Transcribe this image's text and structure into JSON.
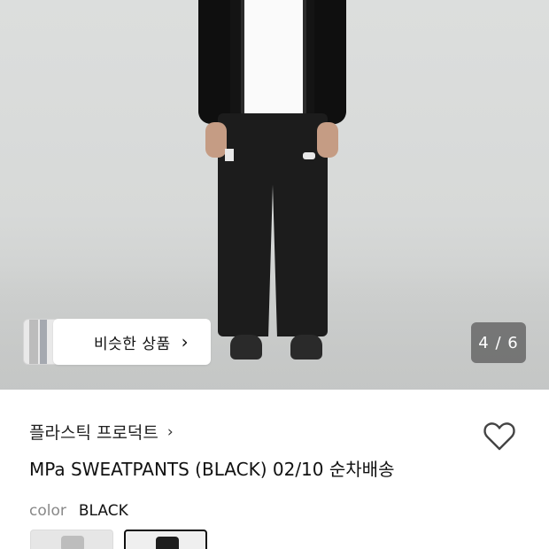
{
  "gallery": {
    "similar_products_label": "비슷한 상품",
    "page_indicator": "4 / 6",
    "current_index": 4,
    "total_images": 6
  },
  "product": {
    "brand": "플라스틱 프로덕트",
    "title": "MPa SWEATPANTS (BLACK) 02/10 순차배송",
    "color_label": "color",
    "color_value": "BLACK"
  },
  "swatches": [
    {
      "name": "grey",
      "selected": false
    },
    {
      "name": "black",
      "selected": true
    }
  ],
  "icons": {
    "wishlist": "heart-outline-icon",
    "brand_link": "chevron-right-icon",
    "similar": "chevron-right-icon"
  },
  "colors": {
    "counter_bg": "#5a5a5a",
    "text_primary": "#111111",
    "text_muted": "#888888",
    "selected_border": "#111111"
  }
}
